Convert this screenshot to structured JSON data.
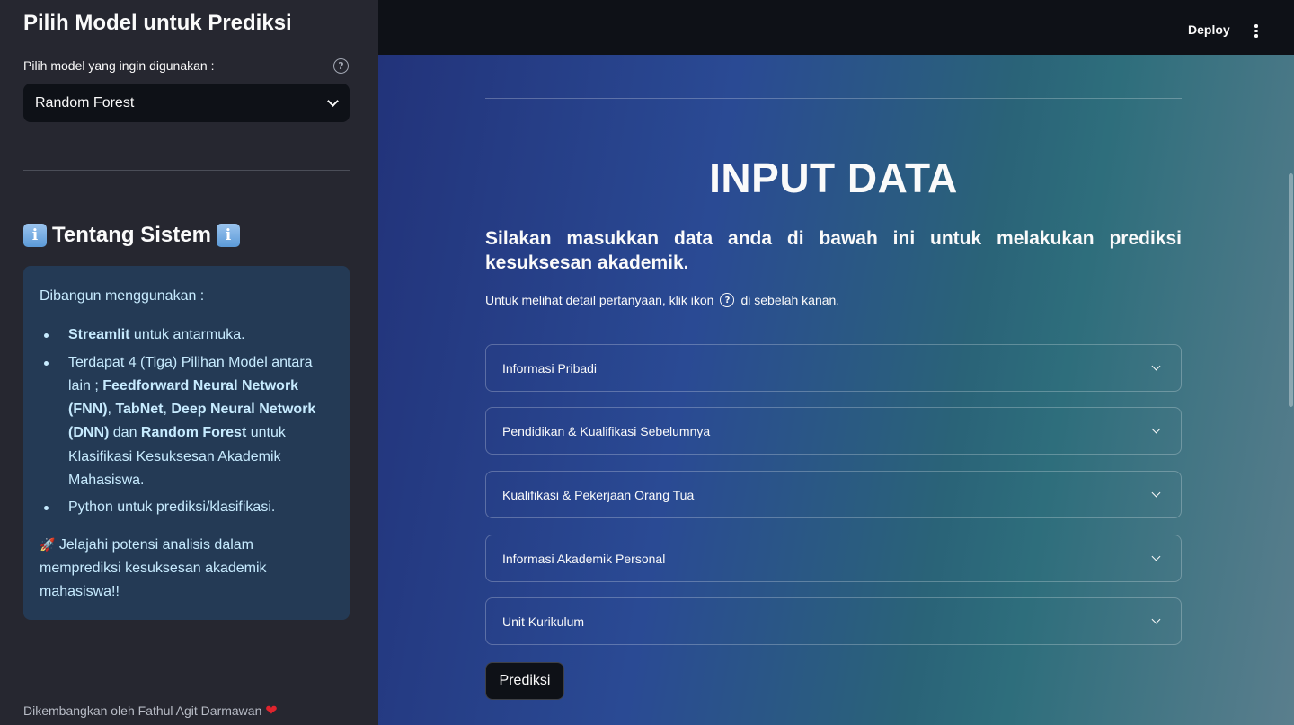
{
  "sidebar": {
    "title": "Pilih Model untuk Prediksi",
    "select_label": "Pilih model yang ingin digunakan :",
    "selected_model": "Random Forest",
    "about_title": "Tentang Sistem",
    "info": {
      "intro": "Dibangun menggunakan :",
      "item1_link": "Streamlit",
      "item1_rest": " untuk antarmuka.",
      "item2_a": "Terdapat 4 (Tiga) Pilihan Model antara lain ; ",
      "item2_b1": "Feedforward Neural Network (FNN)",
      "item2_sep1": ", ",
      "item2_b2": "TabNet",
      "item2_sep2": ", ",
      "item2_b3": "Deep Neural Network (DNN)",
      "item2_sep3": " dan ",
      "item2_b4": "Random Forest",
      "item2_tail": " untuk Klasifikasi Kesuksesan Akademik Mahasiswa.",
      "item3": "Python untuk prediksi/klasifikasi.",
      "closing": " Jelajahi potensi analisis dalam memprediksi kesuksesan akademik mahasiswa!!"
    },
    "footer": "Dikembangkan oleh Fathul Agit Darmawan "
  },
  "header": {
    "deploy_label": "Deploy"
  },
  "main": {
    "title": "INPUT DATA",
    "subtitle": "Silakan masukkan data anda di bawah ini untuk melakukan prediksi kesuksesan akademik.",
    "hint_before": "Untuk melihat detail pertanyaan, klik ikon",
    "hint_after": "di sebelah kanan.",
    "expanders": [
      {
        "label": "Informasi Pribadi"
      },
      {
        "label": "Pendidikan & Kualifikasi Sebelumnya"
      },
      {
        "label": "Kualifikasi & Pekerjaan Orang Tua"
      },
      {
        "label": "Informasi Akademik Personal"
      },
      {
        "label": "Unit Kurikulum"
      }
    ],
    "predict_button": "Prediksi"
  }
}
